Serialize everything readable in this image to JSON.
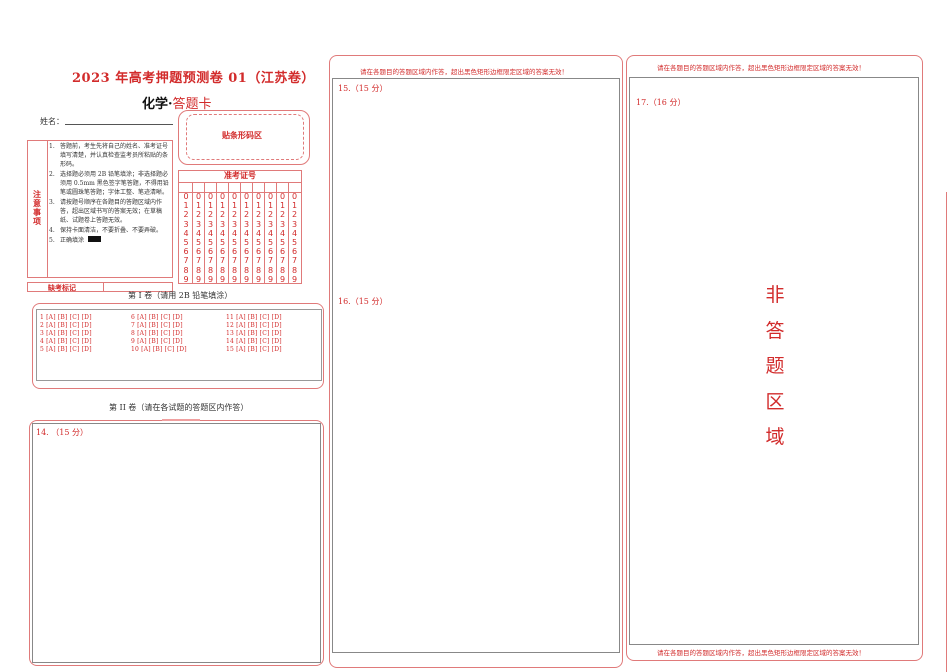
{
  "header": {
    "title": "2023 年高考押题预测卷 01（江苏卷）",
    "subtitle_subject": "化学·",
    "subtitle_card": "答题卡"
  },
  "student": {
    "name_label": "姓名："
  },
  "barcode": {
    "label": "贴条形码区"
  },
  "notice": {
    "heading": "注意事项",
    "items": [
      {
        "num": "1.",
        "text": "答题前，考生先将自己的姓名、准考证号填写清楚，并认真检查监考员所粘贴的条形码。"
      },
      {
        "num": "2.",
        "text": "选择题必须用 2B 铅笔填涂；非选择题必须用 0.5mm 黑色签字笔答题，不得用铅笔或圆珠笔答题；字体工整、笔迹清晰。"
      },
      {
        "num": "3.",
        "text": "请按题号顺序在各题目的答题区域内作答，超出区域书写的答案无效；在草稿纸、试题卷上答题无效。"
      },
      {
        "num": "4.",
        "text": "保持卡面清洁，不要折叠、不要弄破。"
      },
      {
        "num": "5.",
        "text": "正确填涂"
      }
    ],
    "missing_mark": "缺考标记"
  },
  "exam_id": {
    "heading": "准考证号",
    "digits": [
      "0",
      "1",
      "2",
      "3",
      "4",
      "5",
      "6",
      "7",
      "8",
      "9"
    ],
    "columns": 10
  },
  "section1": {
    "title": "第 I 卷（请用 2B 铅笔填涂）",
    "options": "[A] [B] [C] [D]",
    "questions": [
      "1",
      "2",
      "3",
      "4",
      "5",
      "6",
      "7",
      "8",
      "9",
      "10",
      "11",
      "12",
      "13",
      "14",
      "15"
    ]
  },
  "section2": {
    "title": "第 II 卷（请在各试题的答题区内作答）"
  },
  "answer_areas": {
    "q14": "14.  （15 分）",
    "q15": "15.（15 分）",
    "q16": "16.（15 分）",
    "q17": "17.（16 分）"
  },
  "instructions": {
    "middle_top": "请在各题目的答题区域内作答，超出黑色矩形边框限定区域的答案无效！",
    "right_top": "请在各题目的答题区域内作答，超出黑色矩形边框限定区域的答案无效！",
    "right_bottom": "请在各题目的答题区域内作答，超出黑色矩形边框限定区域的答案无效！"
  },
  "non_answer_area": "非答题区域",
  "colors": {
    "accent": "#d22b2b",
    "frame": "#e07a7a",
    "inner_frame": "#888888"
  }
}
